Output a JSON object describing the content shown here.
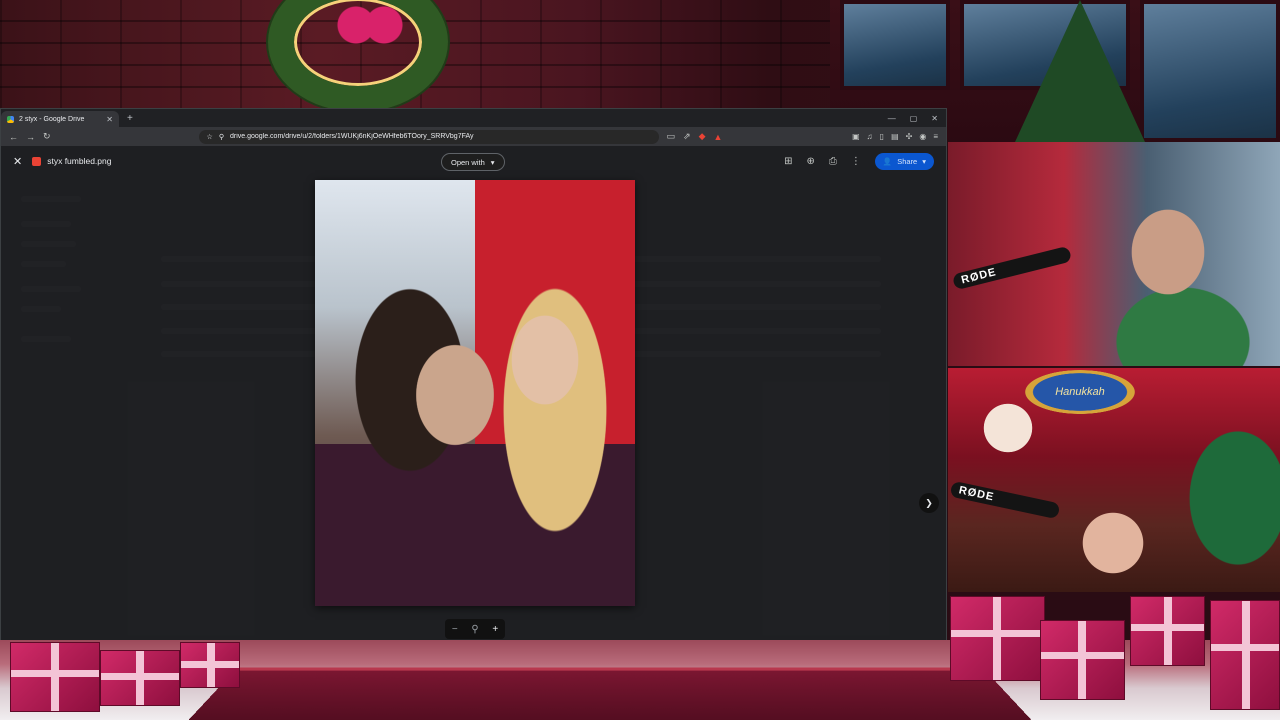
{
  "browser": {
    "tab_title": "2 styx - Google Drive",
    "url": "drive.google.com/drive/u/2/folders/1WUKj6nKjOeWHfeb6TOory_SRRVbg7FAy"
  },
  "viewer": {
    "file_name": "styx fumbled.png",
    "open_with_label": "Open with",
    "share_label": "Share"
  },
  "stream": {
    "mic_brand_1": "RØDE",
    "mic_brand_2": "RØDE",
    "banner_text": "Hanukkah"
  },
  "colors": {
    "share_button": "#0b57d0",
    "viewer_overlay": "#202124",
    "festive_red": "#d12a68"
  }
}
